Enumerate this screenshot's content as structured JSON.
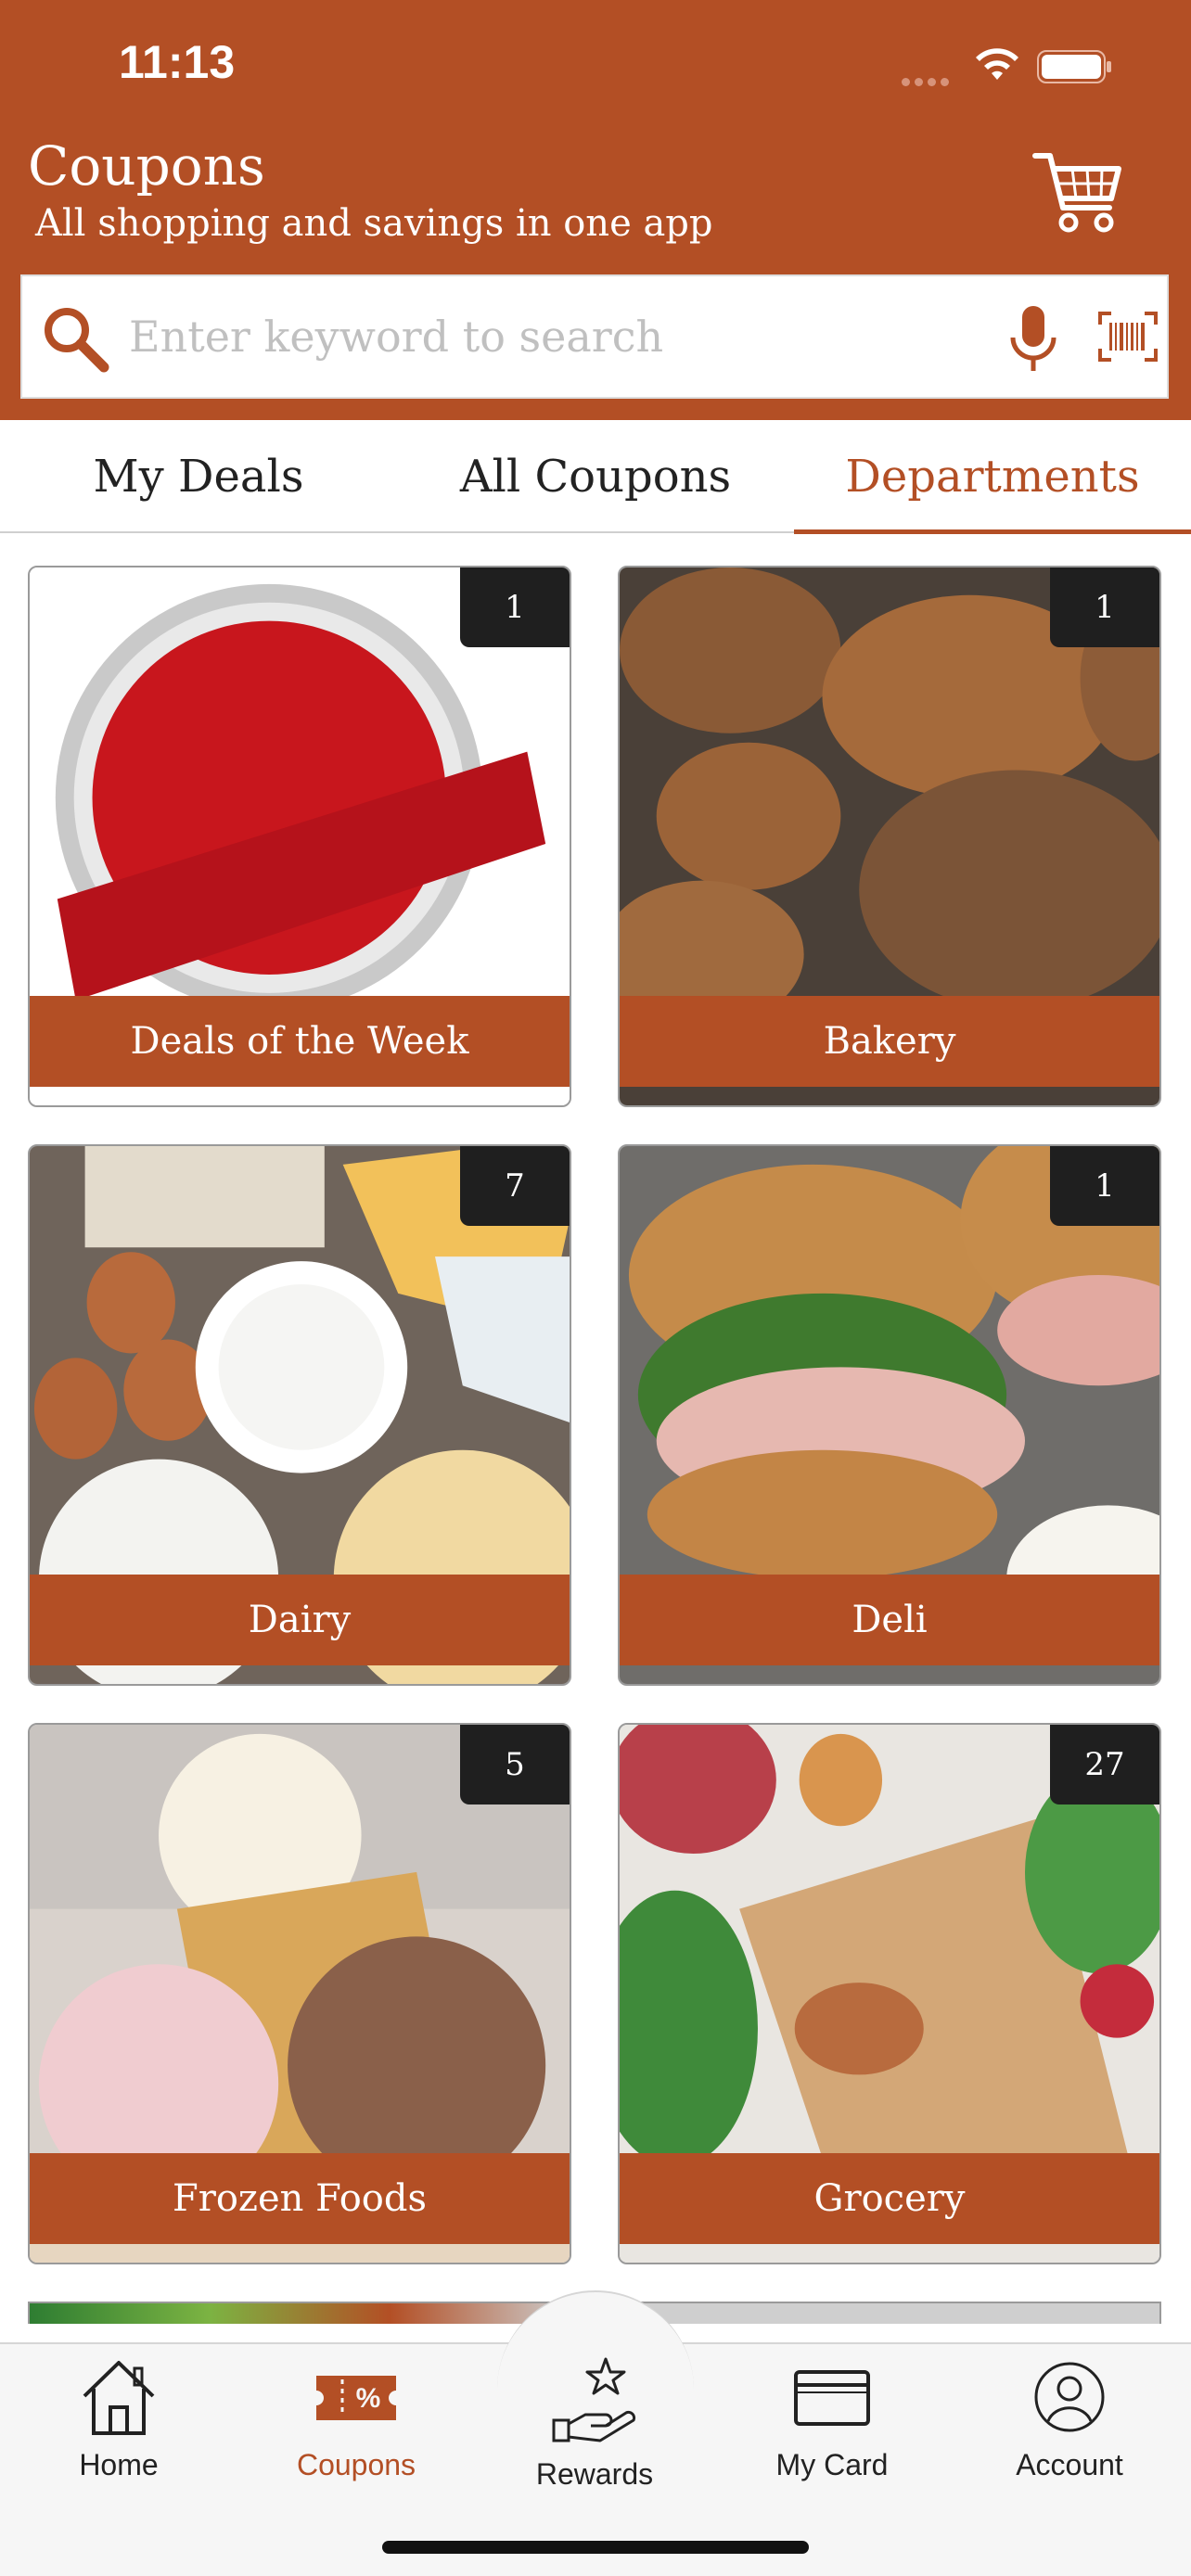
{
  "status_bar": {
    "time": "11:13"
  },
  "header": {
    "title": "Coupons",
    "subtitle": "All shopping and savings in one app"
  },
  "search": {
    "placeholder": "Enter keyword to search"
  },
  "tabs": [
    {
      "label": "My Deals"
    },
    {
      "label": "All Coupons"
    },
    {
      "label": "Departments",
      "active": true
    }
  ],
  "departments": [
    {
      "label": "Deals of the Week",
      "count": "1"
    },
    {
      "label": "Bakery",
      "count": "1"
    },
    {
      "label": "Dairy",
      "count": "7"
    },
    {
      "label": "Deli",
      "count": "1"
    },
    {
      "label": "Frozen Foods",
      "count": "5"
    },
    {
      "label": "Grocery",
      "count": "27"
    }
  ],
  "bottom_nav": [
    {
      "label": "Home"
    },
    {
      "label": "Coupons",
      "active": true
    },
    {
      "label": "Rewards"
    },
    {
      "label": "My Card"
    },
    {
      "label": "Account"
    }
  ],
  "colors": {
    "brand": "#b34f25",
    "badge": "#1f1f1f"
  }
}
